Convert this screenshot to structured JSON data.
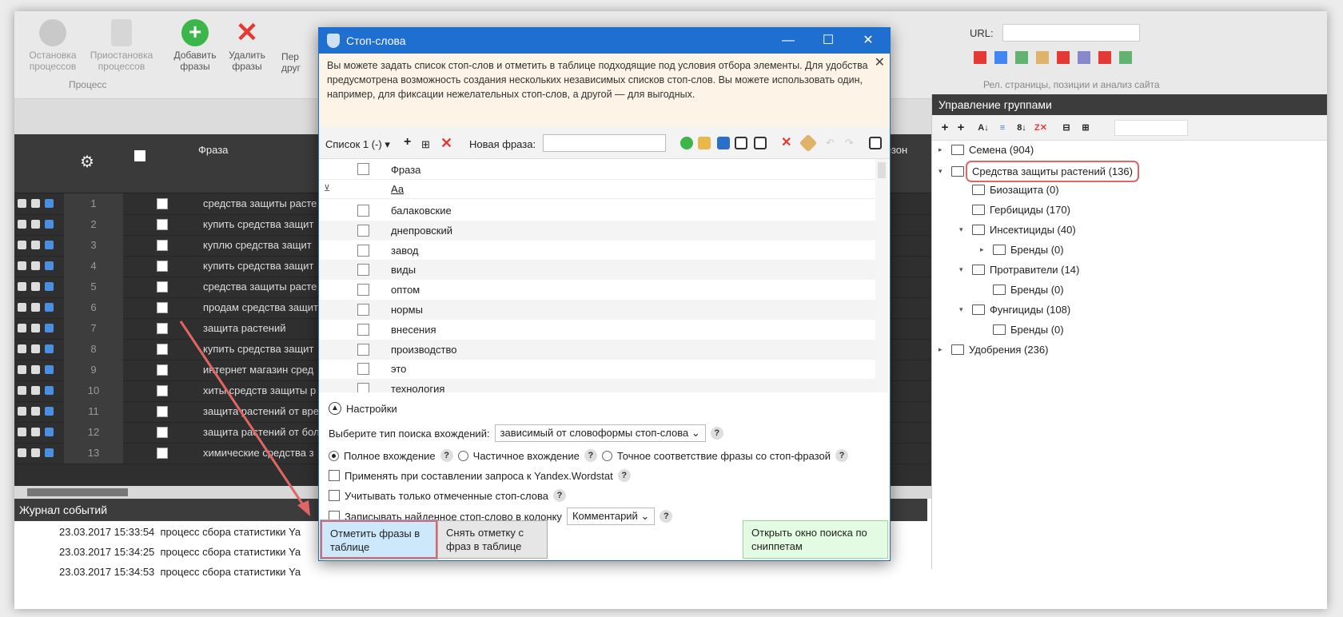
{
  "ribbon": {
    "buttons": [
      {
        "label": "Остановка процессов",
        "disabled": true
      },
      {
        "label": "Приостановка процессов",
        "disabled": true
      },
      {
        "label": "Добавить фразы",
        "disabled": false
      },
      {
        "label": "Удалить фразы",
        "disabled": false
      },
      {
        "label": "Пер друг",
        "disabled": false
      }
    ],
    "group_process": "Процесс",
    "url_label": "URL:",
    "group_analysis": "Рел. страницы, позиции и анализ сайта"
  },
  "grid": {
    "header_phrase": "Фраза",
    "header_right": "езон",
    "rows": [
      {
        "n": "1",
        "phrase": "средства защиты расте"
      },
      {
        "n": "2",
        "phrase": "купить средства защит"
      },
      {
        "n": "3",
        "phrase": "куплю средства защит"
      },
      {
        "n": "4",
        "phrase": "купить средства защит"
      },
      {
        "n": "5",
        "phrase": "средства защиты расте"
      },
      {
        "n": "6",
        "phrase": "продам средства защит"
      },
      {
        "n": "7",
        "phrase": "защита растений"
      },
      {
        "n": "8",
        "phrase": "купить средства защит"
      },
      {
        "n": "9",
        "phrase": "интернет магазин сред"
      },
      {
        "n": "10",
        "phrase": "хиты средств защиты р"
      },
      {
        "n": "11",
        "phrase": "защита растений от вре"
      },
      {
        "n": "12",
        "phrase": "защита растений от бол"
      },
      {
        "n": "13",
        "phrase": "химические средства з"
      }
    ]
  },
  "log": {
    "title": "Журнал событий",
    "rows": [
      {
        "time": "23.03.2017 15:33:54",
        "text": "процесс сбора статистики Ya"
      },
      {
        "time": "23.03.2017 15:34:25",
        "text": "процесс сбора статистики Ya"
      },
      {
        "time": "23.03.2017 15:34:53",
        "text": "процесс сбора статистики Ya"
      }
    ]
  },
  "groups": {
    "title": "Управление группами",
    "tree": [
      {
        "label": "Семена (904)"
      },
      {
        "label": "Средства защиты растений (136)"
      },
      {
        "label": "Биозащита (0)"
      },
      {
        "label": "Гербициды (170)"
      },
      {
        "label": "Инсектициды (40)"
      },
      {
        "label": "Бренды (0)"
      },
      {
        "label": "Протравители (14)"
      },
      {
        "label": "Бренды (0)"
      },
      {
        "label": "Фунгициды (108)"
      },
      {
        "label": "Бренды (0)"
      },
      {
        "label": "Удобрения (236)"
      }
    ]
  },
  "dialog": {
    "title": "Стоп-слова",
    "info": "Вы можете задать список стоп-слов и отметить в таблице подходящие под условия отбора элементы. Для удобства предусмотрена возможность создания нескольких независимых списков стоп-слов. Вы можете использовать один, например, для фиксации нежелательных стоп-слов, а другой — для выгодных.",
    "list_select": "Список 1 (-)",
    "new_phrase_label": "Новая фраза:",
    "col_phrase": "Фраза",
    "filter_placeholder": "Аа",
    "words": [
      "балаковские",
      "днепровский",
      "завод",
      "виды",
      "оптом",
      "нормы",
      "внесения",
      "производство",
      "это",
      "технология"
    ],
    "settings_title": "Настройки",
    "search_type_label": "Выберите тип поиска вхождений:",
    "search_type_value": "зависимый от словоформы стоп-слова",
    "radio_full": "Полное вхождение",
    "radio_partial": "Частичное вхождение",
    "radio_exact": "Точное соответствие фразы со стоп-фразой",
    "opt_wordstat": "Применять при составлении запроса к Yandex.Wordstat",
    "opt_marked": "Учитывать только отмеченные стоп-слова",
    "opt_write": "Записывать найденное стоп-слово в колонку",
    "column_value": "Комментарий",
    "btn_mark": "Отметить фразы в таблице",
    "btn_unmark": "Снять отметку с фраз в таблице",
    "btn_snippets": "Открыть окно поиска по сниппетам"
  },
  "colors": {
    "accent": "#1e6fd0",
    "highlight": "#e06666",
    "info_bg": "#fdf3e6"
  }
}
